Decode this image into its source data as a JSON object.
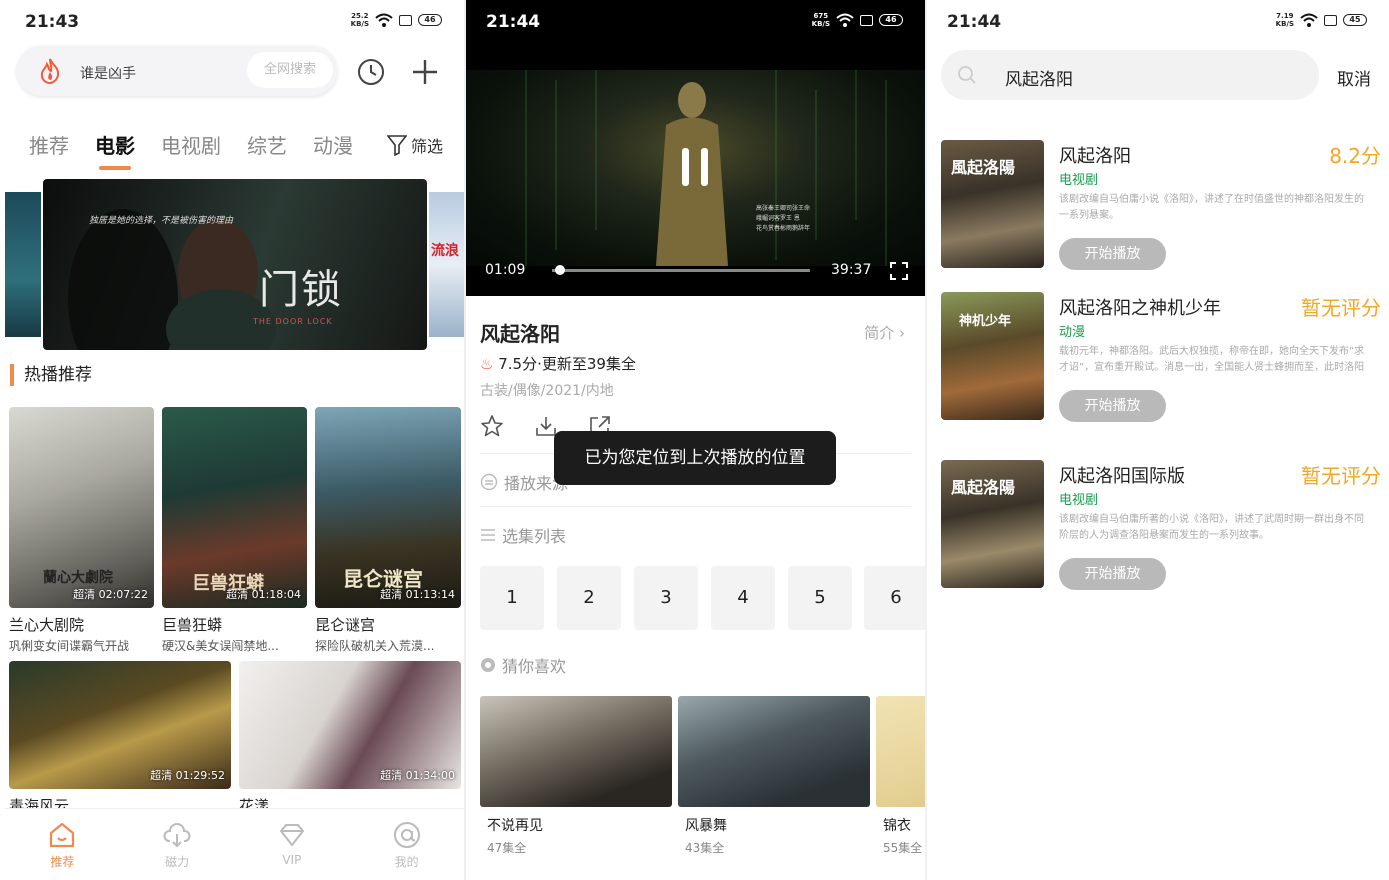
{
  "screen1": {
    "status": {
      "time": "21:43",
      "speed_top": "25.2",
      "speed_bottom": "KB/S",
      "battery": "46"
    },
    "search": {
      "placeholder": "谁是凶手",
      "all_button": "全网搜索"
    },
    "tabs": [
      "推荐",
      "电影",
      "电视剧",
      "综艺",
      "动漫"
    ],
    "filter_label": "筛选",
    "banner": {
      "title": "门锁",
      "subtitle": "独居是她的选择，不是被伤害的理由",
      "english": "THE DOOR LOCK",
      "side_right_text": "流浪"
    },
    "section_title": "热播推荐",
    "cards": [
      {
        "name": "兰心大剧院",
        "desc": "巩俐变女间谍霸气开战",
        "badge": "超清 02:07:22",
        "poster_text": "蘭心大劇院"
      },
      {
        "name": "巨兽狂蟒",
        "desc": "硬汉&美女误闯禁地...",
        "badge": "超清 01:18:04",
        "poster_text": "巨兽狂蟒"
      },
      {
        "name": "昆仑谜宫",
        "desc": "探险队破机关入荒漠...",
        "badge": "超清 01:13:14",
        "poster_text": "昆仑谜宫"
      },
      {
        "name": "毒海风云",
        "desc": "",
        "badge": "超清 01:29:52"
      },
      {
        "name": "花漾",
        "desc": "",
        "badge": "超清 01:34:00"
      }
    ],
    "nav": [
      {
        "label": "推荐",
        "active": true
      },
      {
        "label": "磁力",
        "active": false
      },
      {
        "label": "VIP",
        "active": false
      },
      {
        "label": "我的",
        "active": false
      }
    ]
  },
  "screen2": {
    "status": {
      "time": "21:44",
      "speed_top": "675",
      "speed_bottom": "KB/S",
      "battery": "46"
    },
    "player": {
      "current": "01:09",
      "total": "39:37",
      "progress": 0.03
    },
    "title": "风起洛阳",
    "intro": "简介",
    "score": "7.5分·更新至39集全",
    "meta": "古装/偶像/2021/内地",
    "toast": "已为您定位到上次播放的位置",
    "source_label": "播放来源",
    "episodes_label": "选集列表",
    "episodes": [
      "1",
      "2",
      "3",
      "4",
      "5",
      "6"
    ],
    "guess_label": "猜你喜欢",
    "recs": [
      {
        "name": "不说再见",
        "desc": "47集全"
      },
      {
        "name": "风暴舞",
        "desc": "43集全"
      },
      {
        "name": "锦衣",
        "desc": "55集全"
      }
    ]
  },
  "screen3": {
    "status": {
      "time": "21:44",
      "speed_top": "7.19",
      "speed_bottom": "KB/S",
      "battery": "45"
    },
    "query": "风起洛阳",
    "cancel": "取消",
    "results": [
      {
        "name": "风起洛阳",
        "score": "8.2分",
        "type": "电视剧",
        "desc": "该剧改编自马伯庸小说《洛阳》，讲述了在时值盛世的神都洛阳发生的一系列悬案。",
        "button": "开始播放",
        "poster_text": "風起洛陽"
      },
      {
        "name": "风起洛阳之神机少年",
        "score": "暂无评分",
        "type": "动漫",
        "desc": "载初元年，神都洛阳。武后大权独揽，称帝在即，她向全天下发布“求才诏”，宣布重开殿试。消息一出，全国能人贤士蜂拥而至，此时洛阳城却冒出来一只肆无忌惮的狐妖，她神出...",
        "button": "开始播放",
        "poster_text": "神机少年"
      },
      {
        "name": "风起洛阳国际版",
        "score": "暂无评分",
        "type": "电视剧",
        "desc": "该剧改编自马伯庸所著的小说《洛阳》，讲述了武周时期一群出身不同阶层的人为调查洛阳悬案而发生的一系列故事。",
        "button": "开始播放",
        "poster_text": "風起洛陽"
      }
    ]
  },
  "colors": {
    "accent": "#f08a4b",
    "score": "#f5a623",
    "type_green": "#1a9d4b"
  }
}
